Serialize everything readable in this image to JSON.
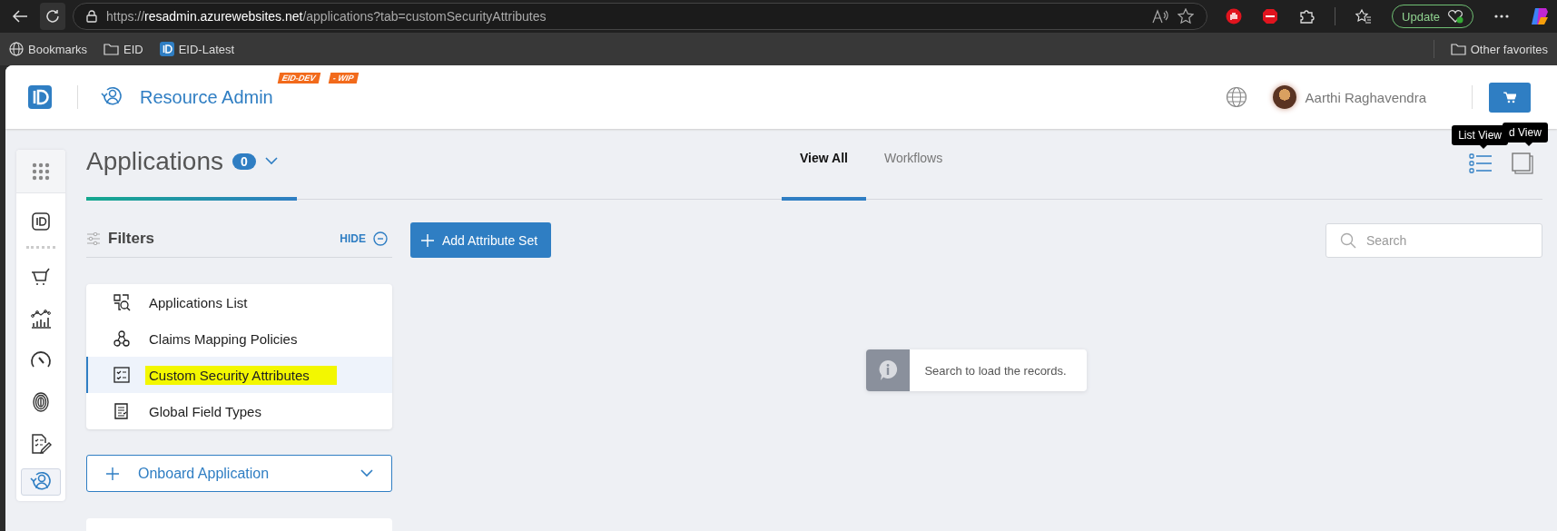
{
  "browser": {
    "url_scheme": "https://",
    "url_host": "resadmin.azurewebsites.net",
    "url_path": "/applications?tab=customSecurityAttributes",
    "update_button": "Update",
    "bookmarks": [
      {
        "label": "Bookmarks",
        "kind": "globe"
      },
      {
        "label": "EID",
        "kind": "folder"
      },
      {
        "label": "EID-Latest",
        "kind": "logo"
      }
    ],
    "other_favorites": "Other favorites"
  },
  "header": {
    "app_title": "Resource Admin",
    "badges": [
      "EID-DEV",
      "- WIP"
    ],
    "user_name": "Aarthi Raghavendra"
  },
  "rail": {
    "items": [
      {
        "kind": "id",
        "selected": false
      },
      {
        "kind": "cart",
        "selected": false
      },
      {
        "kind": "chart",
        "selected": false
      },
      {
        "kind": "gauge",
        "selected": false
      },
      {
        "kind": "fingerprint",
        "selected": false
      },
      {
        "kind": "document",
        "selected": false
      },
      {
        "kind": "resource",
        "selected": true
      }
    ]
  },
  "page": {
    "title": "Applications",
    "count": "0",
    "tabs": [
      {
        "label": "View All",
        "selected": true
      },
      {
        "label": "Workflows",
        "selected": false
      }
    ],
    "view_modes": [
      {
        "kind": "list",
        "selected": true,
        "tooltip": "List View"
      },
      {
        "kind": "grid",
        "selected": false,
        "tooltip": "d View"
      }
    ]
  },
  "filters": {
    "title": "Filters",
    "hide": "HIDE",
    "items": [
      {
        "label": "Applications List",
        "kind": "list",
        "selected": false,
        "highlighted": false
      },
      {
        "label": "Claims Mapping Policies",
        "kind": "claims",
        "selected": false,
        "highlighted": false
      },
      {
        "label": "Custom Security Attributes",
        "kind": "attributes",
        "selected": true,
        "highlighted": true
      },
      {
        "label": "Global Field Types",
        "kind": "fields",
        "selected": false,
        "highlighted": false
      }
    ]
  },
  "onboard_button": "Onboard Application",
  "toolbar": {
    "add_button": "Add Attribute Set",
    "search": {
      "placeholder": "Search"
    }
  },
  "message": "Search to load the records."
}
